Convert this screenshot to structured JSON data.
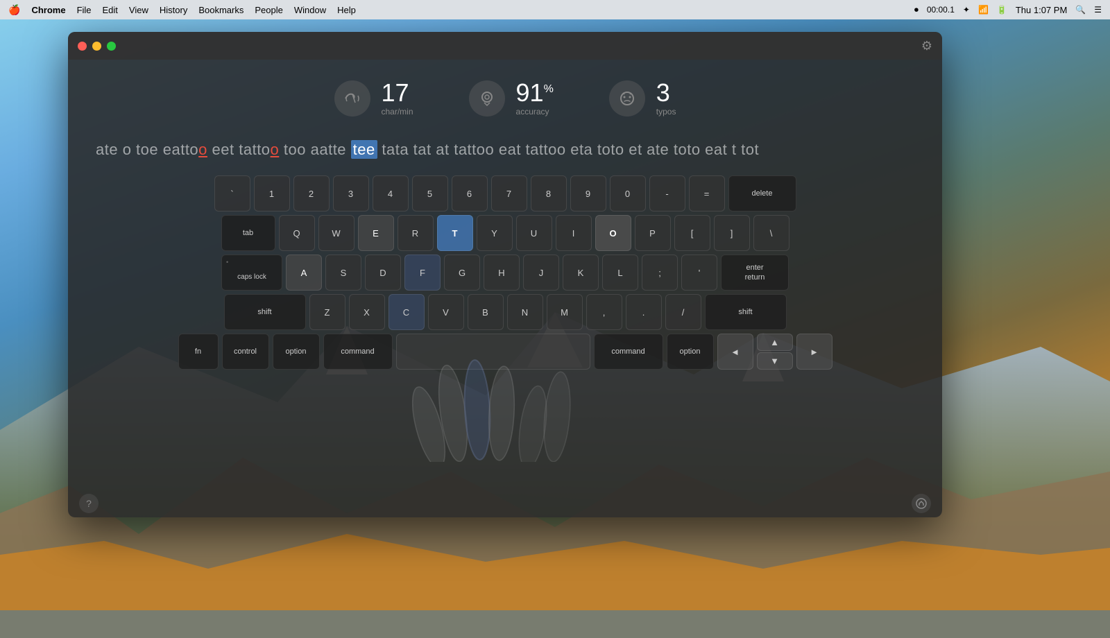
{
  "menubar": {
    "apple": "🍎",
    "app_name": "Chrome",
    "menus": [
      "File",
      "Edit",
      "View",
      "History",
      "Bookmarks",
      "People",
      "Window",
      "Help"
    ],
    "time": "Thu 1:07 PM",
    "recording": "00:00.1"
  },
  "stats": {
    "speed_value": "17",
    "speed_label": "char/min",
    "accuracy_value": "91",
    "accuracy_unit": "%",
    "accuracy_label": "accuracy",
    "typos_value": "3",
    "typos_label": "typos"
  },
  "typing": {
    "text_before": "ate o toe eatto",
    "error1": "o",
    "text2": " eet tatto",
    "error2": "o",
    "text3": " too aatte ",
    "current": "tee",
    "text_after": " tata tat at tattoo eat tattoo eta toto et ate toto eat t tot"
  },
  "keyboard": {
    "row1": [
      "`",
      "1",
      "2",
      "3",
      "4",
      "5",
      "6",
      "7",
      "8",
      "9",
      "0",
      "-",
      "=",
      "delete"
    ],
    "row2": [
      "tab",
      "Q",
      "W",
      "E",
      "R",
      "T",
      "Y",
      "U",
      "I",
      "O",
      "P",
      "[",
      "]",
      "\\"
    ],
    "row3": [
      "caps lock",
      "A",
      "S",
      "D",
      "F",
      "G",
      "H",
      "J",
      "K",
      "L",
      ";",
      "'",
      "enter\nreturn"
    ],
    "row4": [
      "shift",
      "Z",
      "X",
      "C",
      "V",
      "B",
      "N",
      "M",
      ",",
      ".",
      "/",
      "shift"
    ],
    "row5": [
      "fn",
      "control",
      "option",
      "command",
      "",
      "command",
      "option",
      "◄",
      "▲\n▼",
      "►"
    ]
  },
  "footer": {
    "help": "?",
    "stats_icon": "📊"
  }
}
